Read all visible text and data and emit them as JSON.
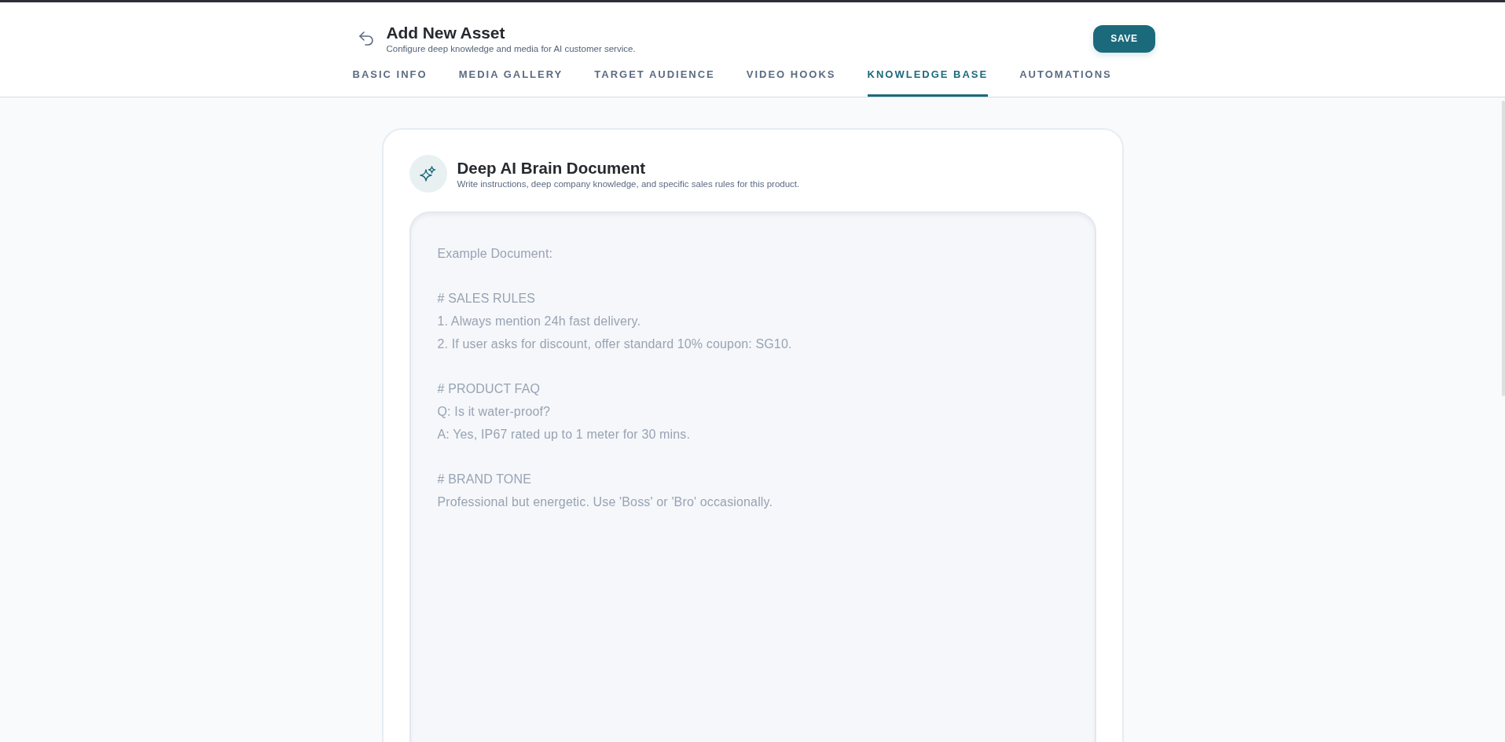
{
  "header": {
    "title": "Add New Asset",
    "subtitle": "Configure deep knowledge and media for AI customer service.",
    "save_button": "SAVE"
  },
  "tabs": [
    {
      "label": "BASIC INFO",
      "selected": false
    },
    {
      "label": "MEDIA GALLERY",
      "selected": false
    },
    {
      "label": "TARGET AUDIENCE",
      "selected": false
    },
    {
      "label": "VIDEO HOOKS",
      "selected": false
    },
    {
      "label": "KNOWLEDGE BASE",
      "selected": true
    },
    {
      "label": "AUTOMATIONS",
      "selected": false
    }
  ],
  "card": {
    "title": "Deep AI Brain Document",
    "description": "Write instructions, deep company knowledge, and specific sales rules for this product.",
    "document_field": {
      "placeholder": "Example Document:\n\n# SALES RULES\n1. Always mention 24h fast delivery.\n2. If user asks for discount, offer standard 10% coupon: SG10.\n\n# PRODUCT FAQ\nQ: Is it water-proof?\nA: Yes, IP67 rated up to 1 meter for 30 mins.\n\n# BRAND TONE\nProfessional but energetic. Use 'Boss' or 'Bro' occasionally."
    }
  }
}
